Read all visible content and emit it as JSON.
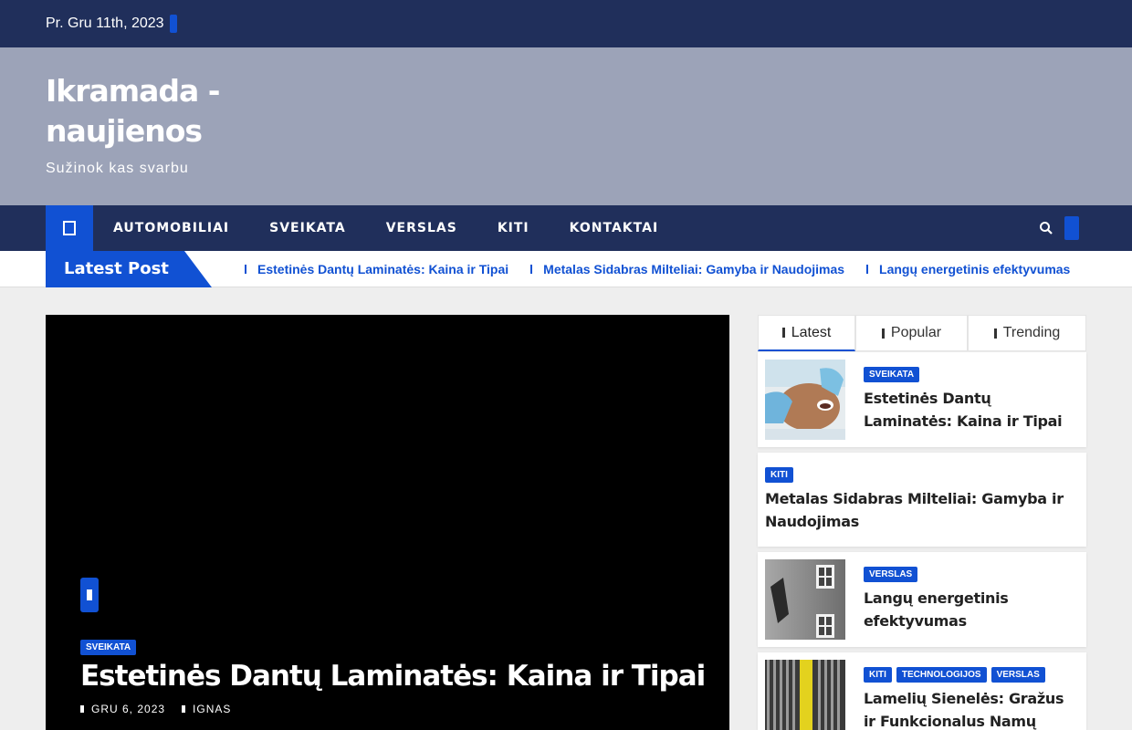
{
  "topbar": {
    "date": "Pr. Gru 11th, 2023"
  },
  "site": {
    "title": "Ikramada - naujienos",
    "tagline": "Sužinok kas svarbu"
  },
  "nav": {
    "items": [
      "AUTOMOBILIAI",
      "SVEIKATA",
      "VERSLAS",
      "KITI",
      "KONTAKTAI"
    ]
  },
  "ticker": {
    "label": "Latest Post",
    "items": [
      "Estetinės Dantų Laminatės: Kaina ir Tipai",
      "Metalas Sidabras Milteliai: Gamyba ir Naudojimas",
      "Langų energetinis efektyvumas"
    ]
  },
  "hero": {
    "category": "SVEIKATA",
    "title": "Estetinės Dantų Laminatės: Kaina ir Tipai",
    "date": "GRU 6, 2023",
    "author": "IGNAS"
  },
  "sidebar": {
    "tabs": [
      "Latest",
      "Popular",
      "Trending"
    ],
    "posts": [
      {
        "categories": [
          "SVEIKATA"
        ],
        "title": "Estetinės Dantų Laminatės: Kaina ir Tipai"
      },
      {
        "categories": [
          "KITI"
        ],
        "title": "Metalas Sidabras Milteliai: Gamyba ir Naudojimas"
      },
      {
        "categories": [
          "VERSLAS"
        ],
        "title": "Langų energetinis efektyvumas"
      },
      {
        "categories": [
          "KITI",
          "TECHNOLOGIJOS",
          "VERSLAS"
        ],
        "title": "Lamelių Sienelės: Gražus ir Funkcionalus Namų"
      }
    ]
  },
  "colors": {
    "navy": "#202f5b",
    "accent": "#1151d3",
    "header_bg": "#9ca3b8"
  }
}
